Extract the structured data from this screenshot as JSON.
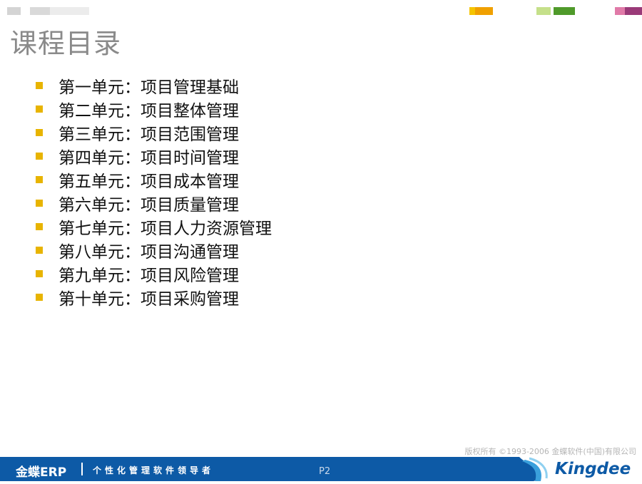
{
  "title": "课程目录",
  "toc": [
    "第一单元：项目管理基础",
    "第二单元：项目整体管理",
    "第三单元：项目范围管理",
    "第四单元：项目时间管理",
    "第五单元：项目成本管理",
    "第六单元：项目质量管理",
    "第七单元：项目人力资源管理",
    "第八单元：项目沟通管理",
    "第九单元：项目风险管理",
    "第十单元：项目采购管理"
  ],
  "copyright": "版权所有 ©1993-2006 金蝶软件(中国)有限公司",
  "footer": {
    "brand": "金蝶ERP",
    "slogan": "个性化管理软件领导者",
    "page": "P2",
    "logo": "Kingdee"
  },
  "colors": {
    "bullet": "#e8b400",
    "footer_bg": "#0d5aa6",
    "title": "#8a8a8a"
  }
}
